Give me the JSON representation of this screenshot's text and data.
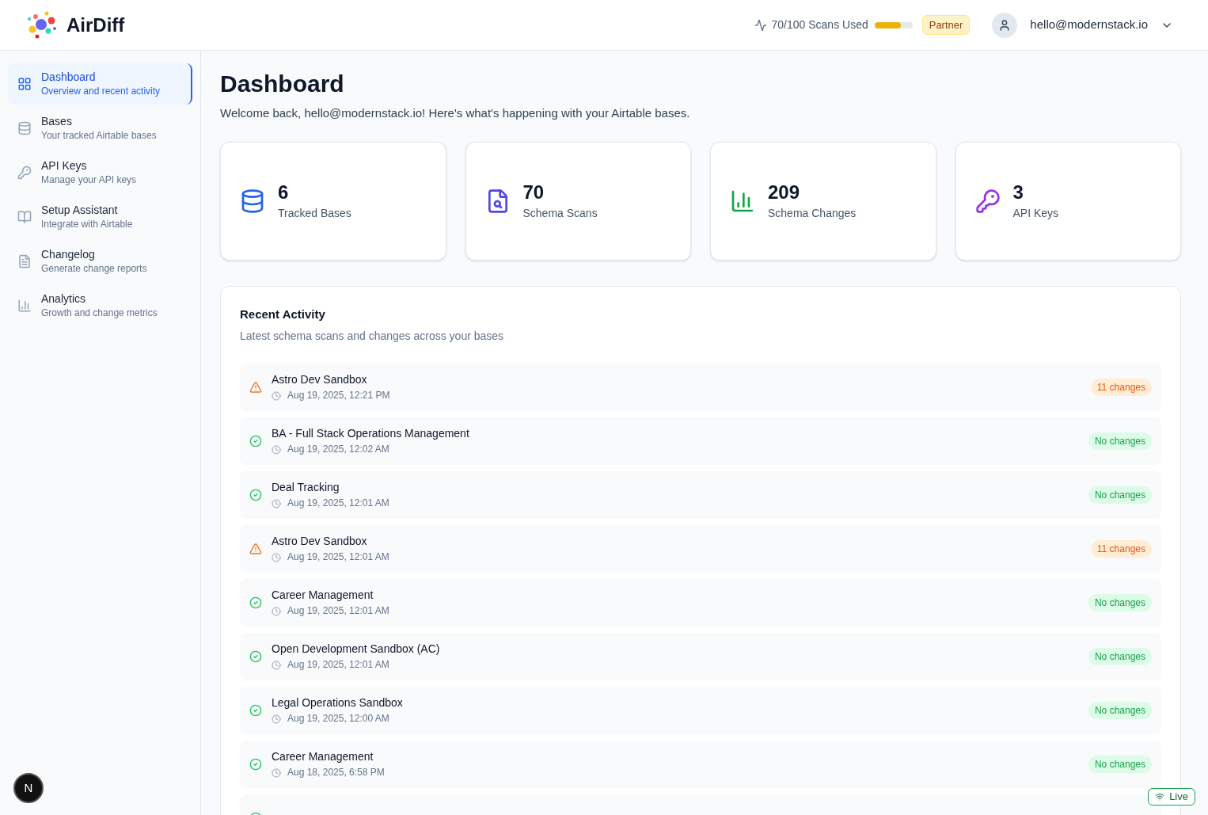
{
  "brand": {
    "name": "AirDiff"
  },
  "header": {
    "usage": "70/100 Scans Used",
    "usage_bar": {
      "level": 0.7
    },
    "plan": "Partner",
    "user_email": "hello@modernstack.io"
  },
  "sidebar": {
    "items": [
      {
        "kind": "dashboard",
        "label": "Dashboard",
        "description": "Overview and recent activity",
        "selected": true
      },
      {
        "kind": "bases",
        "label": "Bases",
        "description": "Your tracked Airtable bases",
        "selected": false
      },
      {
        "kind": "keys",
        "label": "API Keys",
        "description": "Manage your API keys",
        "selected": false
      },
      {
        "kind": "setup",
        "label": "Setup Assistant",
        "description": "Integrate with Airtable",
        "selected": false
      },
      {
        "kind": "changelog",
        "label": "Changelog",
        "description": "Generate change reports",
        "selected": false
      },
      {
        "kind": "analytics",
        "label": "Analytics",
        "description": "Growth and change metrics",
        "selected": false
      }
    ],
    "corner_button": "N"
  },
  "page": {
    "title": "Dashboard",
    "subtitle": "Welcome back, hello@modernstack.io! Here's what's happening with your Airtable bases."
  },
  "stats": [
    {
      "kind": "bases",
      "value": "6",
      "label": "Tracked Bases"
    },
    {
      "kind": "scans",
      "value": "70",
      "label": "Schema Scans"
    },
    {
      "kind": "changes",
      "value": "209",
      "label": "Schema Changes"
    },
    {
      "kind": "keys",
      "value": "3",
      "label": "API Keys"
    }
  ],
  "recent_activity": {
    "title": "Recent Activity",
    "subtitle": "Latest schema scans and changes across your bases",
    "items": [
      {
        "kind": "changed",
        "name": "Astro Dev Sandbox",
        "time": "Aug 19, 2025, 12:21 PM",
        "badge": "11 changes"
      },
      {
        "kind": "unchanged",
        "name": "BA - Full Stack Operations Management",
        "time": "Aug 19, 2025, 12:02 AM",
        "badge": "No changes"
      },
      {
        "kind": "unchanged",
        "name": "Deal Tracking",
        "time": "Aug 19, 2025, 12:01 AM",
        "badge": "No changes"
      },
      {
        "kind": "changed",
        "name": "Astro Dev Sandbox",
        "time": "Aug 19, 2025, 12:01 AM",
        "badge": "11 changes"
      },
      {
        "kind": "unchanged",
        "name": "Career Management",
        "time": "Aug 19, 2025, 12:01 AM",
        "badge": "No changes"
      },
      {
        "kind": "unchanged",
        "name": "Open Development Sandbox (AC)",
        "time": "Aug 19, 2025, 12:01 AM",
        "badge": "No changes"
      },
      {
        "kind": "unchanged",
        "name": "Legal Operations Sandbox",
        "time": "Aug 19, 2025, 12:00 AM",
        "badge": "No changes"
      },
      {
        "kind": "unchanged",
        "name": "Career Management",
        "time": "Aug 18, 2025, 6:58 PM",
        "badge": "No changes"
      },
      {
        "kind": "unchanged"
      }
    ]
  },
  "live_indicator": "Live"
}
